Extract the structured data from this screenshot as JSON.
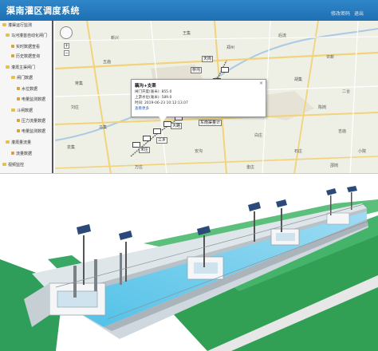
{
  "app": {
    "title": "渠南灌区调度系统",
    "links": {
      "change_password": "修改密码",
      "logout": "退出"
    }
  },
  "sidebar": {
    "items": [
      "灌渠运行监测",
      "马河灌首自动化闸门",
      "实时数据查看",
      "历史数据查询",
      "灌溉主渠闸门",
      "闸门数据",
      "水位数据",
      "电量监测数据",
      "斗闸数据",
      "压力流量数据",
      "电量监测数据",
      "灌溉量流量",
      "流量数据",
      "视频监控"
    ]
  },
  "map": {
    "labels": [
      "新兴",
      "王集",
      "后流",
      "郑州",
      "五庙",
      "许新",
      "蒋集",
      "胡集",
      "二合",
      "刘庄",
      "陈岗",
      "马集",
      "白庄",
      "吉庙",
      "泉集",
      "安沟",
      "石庄",
      "小院",
      "万庄",
      "金庄",
      "邵岗"
    ],
    "station_tags": [
      "天岗",
      "桥沟",
      "大路",
      "三乡",
      "宋庄",
      "东南渠量计"
    ],
    "popup": {
      "title": "藕沟+支渠",
      "lines": [
        "闸门开度(毫米): 855.0",
        "上游水位(毫米): 589.0",
        "时间: 2019-06-23 10:12:13.07"
      ],
      "link": "查看更多"
    }
  }
}
